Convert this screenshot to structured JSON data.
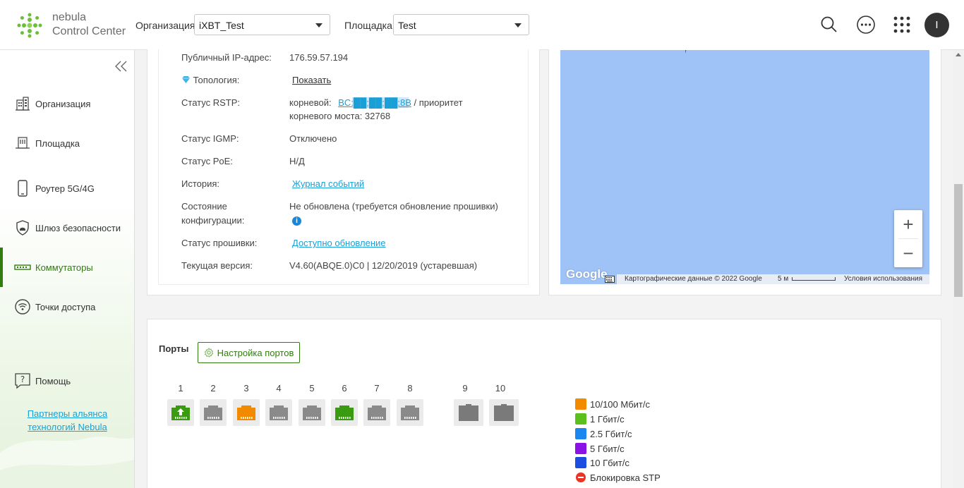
{
  "header": {
    "logo_line1": "nebula",
    "logo_line2": "Control Center",
    "org_label": "Организация:",
    "org_value": "iXBT_Test",
    "site_label": "Площадка:",
    "site_value": "Test",
    "avatar_letter": "I"
  },
  "sidebar": {
    "items": [
      {
        "label": "Организация",
        "icon": "building-icon"
      },
      {
        "label": "Площадка",
        "icon": "site-icon"
      },
      {
        "label": "Роутер 5G/4G",
        "icon": "phone-icon"
      },
      {
        "label": "Шлюз безопасности",
        "icon": "shield-icon"
      },
      {
        "label": "Коммутаторы",
        "icon": "switch-icon"
      },
      {
        "label": "Точки доступа",
        "icon": "wifi-icon"
      }
    ],
    "help_label": "Помощь",
    "partner_line1": "Партнеры альянса",
    "partner_line2": "технологий Nebula"
  },
  "info": {
    "rows": [
      {
        "label": "Публичный IP-адрес:",
        "value": "176.59.57.194"
      },
      {
        "label": "Топология:",
        "value": "Показать"
      },
      {
        "label": "Статус RSTP:",
        "value_prefix": "корневой:",
        "value_link": "BC:██:██:██:8B",
        "value_suffix": "/ приоритет",
        "value_line2": "корневого моста: 32768"
      },
      {
        "label": "Статус IGMP:",
        "value": "Отключено"
      },
      {
        "label": "Статус PoE:",
        "value": "Н/Д"
      },
      {
        "label": "История:",
        "value": "Журнал событий"
      },
      {
        "label_line1": "Состояние",
        "label_line2": "конфигурации:",
        "value": "Не обновлена (требуется обновление прошивки)"
      },
      {
        "label": "Статус прошивки:",
        "value": "Доступно обновление"
      },
      {
        "label": "Текущая версия:",
        "value": "V4.60(ABQE.0)C0 | 12/20/2019 (устаревшая)"
      }
    ]
  },
  "map": {
    "google_text": "Google",
    "attribution": "Картографические данные © 2022 Google",
    "scale": "5 м",
    "terms": "Условия использования",
    "zoom_in": "+",
    "zoom_out": "−"
  },
  "ports": {
    "title": "Порты",
    "settings_button": "Настройка портов",
    "list": [
      {
        "num": "1",
        "color": "#3a9a12",
        "uplink": true
      },
      {
        "num": "2",
        "color": "#8a8a8a"
      },
      {
        "num": "3",
        "color": "#f28a00"
      },
      {
        "num": "4",
        "color": "#8a8a8a"
      },
      {
        "num": "5",
        "color": "#8a8a8a"
      },
      {
        "num": "6",
        "color": "#3a9a12"
      },
      {
        "num": "7",
        "color": "#8a8a8a"
      },
      {
        "num": "8",
        "color": "#8a8a8a"
      },
      {
        "num": "9",
        "color": "#7a7a7a",
        "sfp": true
      },
      {
        "num": "10",
        "color": "#7a7a7a",
        "sfp": true
      }
    ],
    "legend": [
      {
        "label": "10/100 Мбит/с",
        "color": "#f28a00"
      },
      {
        "label": "1 Гбит/с",
        "color": "#5bbf1c"
      },
      {
        "label": "2.5 Гбит/с",
        "color": "#1a87f0"
      },
      {
        "label": "5 Гбит/с",
        "color": "#8a12e6"
      },
      {
        "label": "10 Гбит/с",
        "color": "#1a4de0"
      },
      {
        "label": "Блокировка STP",
        "color": "#e33322"
      }
    ]
  }
}
